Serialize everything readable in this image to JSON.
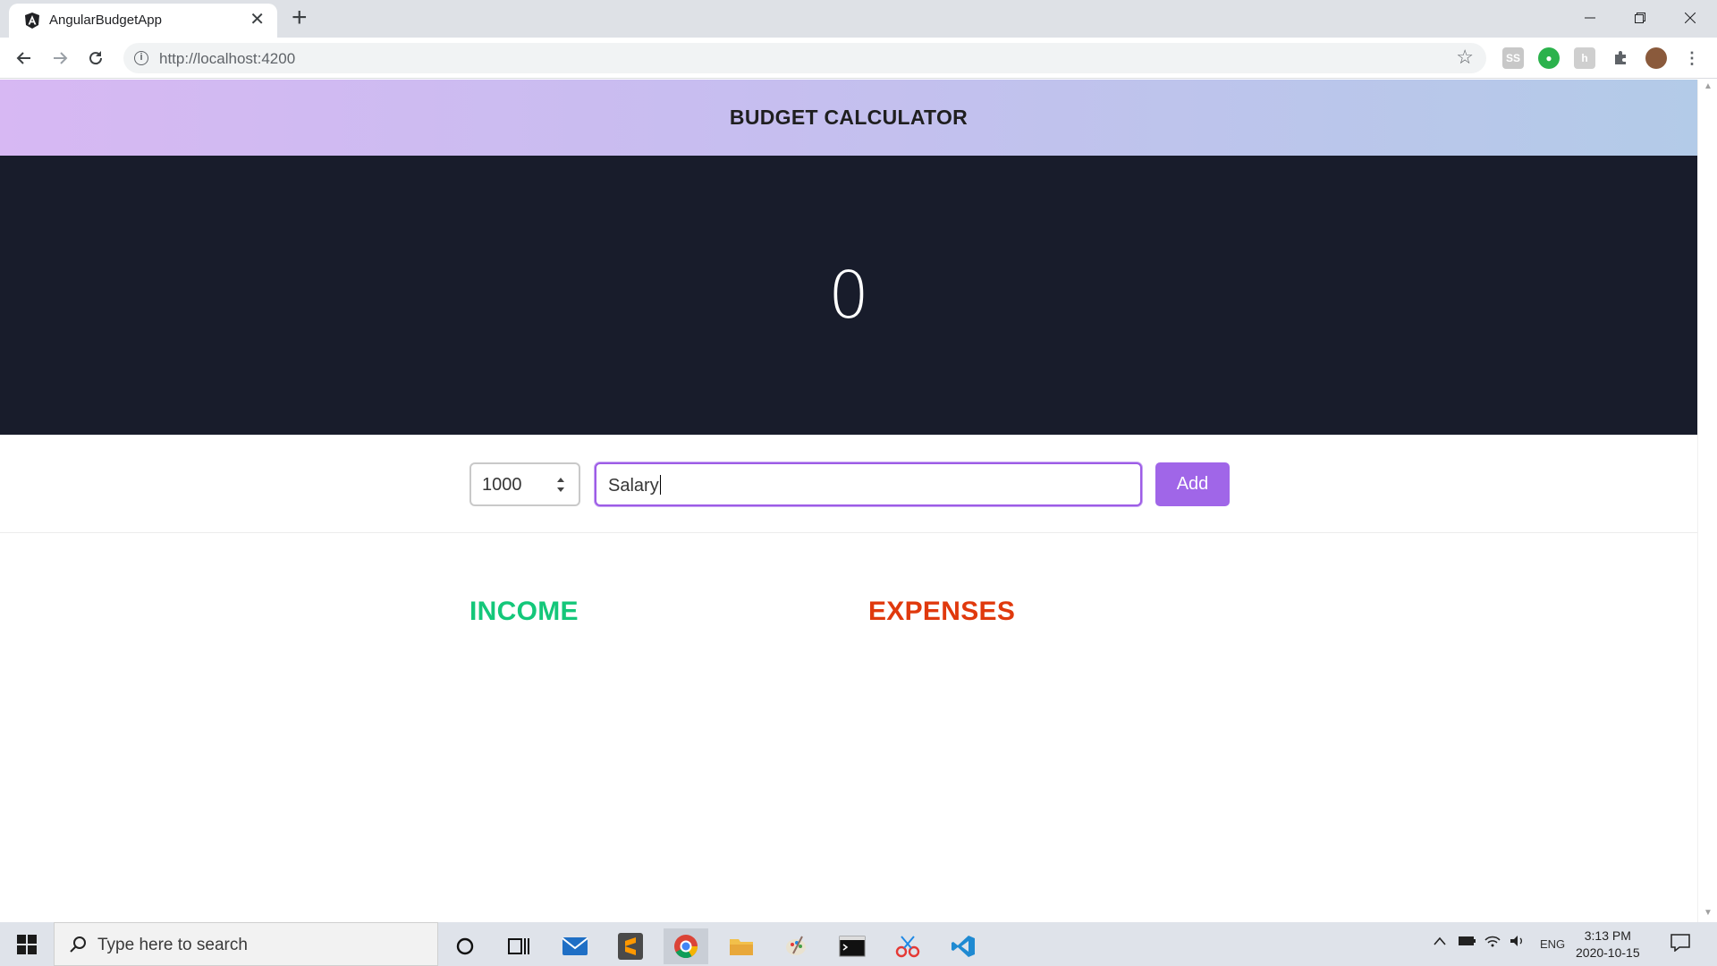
{
  "browser": {
    "tab_title": "AngularBudgetApp",
    "url": "http://localhost:4200",
    "new_tab_label": "+",
    "close_tab_label": "✕"
  },
  "app": {
    "title": "BUDGET CALCULATOR",
    "total_budget": "0",
    "form": {
      "amount_value": "1000",
      "description_value": "Salary",
      "add_label": "Add"
    },
    "income_heading": "INCOME",
    "expenses_heading": "EXPENSES",
    "colors": {
      "income": "#14c77a",
      "expenses": "#e0390d",
      "accent": "#a066e8",
      "panel": "#181c2b"
    }
  },
  "taskbar": {
    "search_placeholder": "Type here to search",
    "time": "3:13 PM",
    "date": "2020-10-15",
    "language": "ENG"
  }
}
